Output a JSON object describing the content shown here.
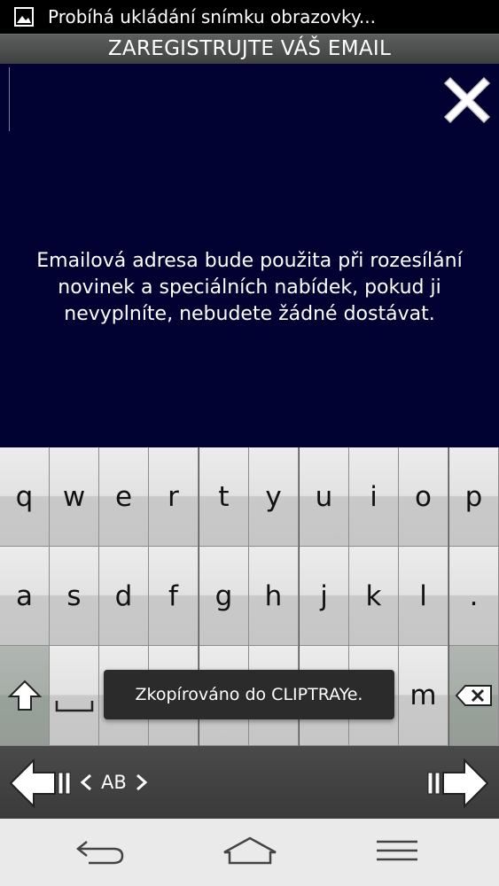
{
  "status_bar": {
    "notification_text": "Probíhá ukládání snímku obrazovky..."
  },
  "title_bar": {
    "title": "ZAREGISTRUJTE VÁŠ EMAIL"
  },
  "main": {
    "lines": [
      "Emailová adresa bude použita při rozesílání",
      "novinek a speciálních nabídek, pokud ji",
      "nevyplníte, nebudete žádné dostávat."
    ]
  },
  "keyboard": {
    "row1": [
      "q",
      "w",
      "e",
      "r",
      "t",
      "y",
      "u",
      "i",
      "o",
      "p"
    ],
    "row2": [
      "a",
      "s",
      "d",
      "f",
      "g",
      "h",
      "j",
      "k",
      "l",
      "."
    ],
    "m_key": "m",
    "lang_label": "AB"
  },
  "toast": {
    "text": "Zkopírováno do CLIPTRAYe."
  },
  "icons": {
    "close": "close-icon",
    "shift": "shift-icon",
    "space": "space-icon",
    "backspace": "backspace-icon",
    "cursor_left": "cursor-left-icon",
    "cursor_right": "cursor-right-icon",
    "back": "back-icon",
    "home": "home-icon",
    "menu": "menu-icon"
  },
  "colors": {
    "background": "#010231",
    "accent": "#ffffff"
  }
}
